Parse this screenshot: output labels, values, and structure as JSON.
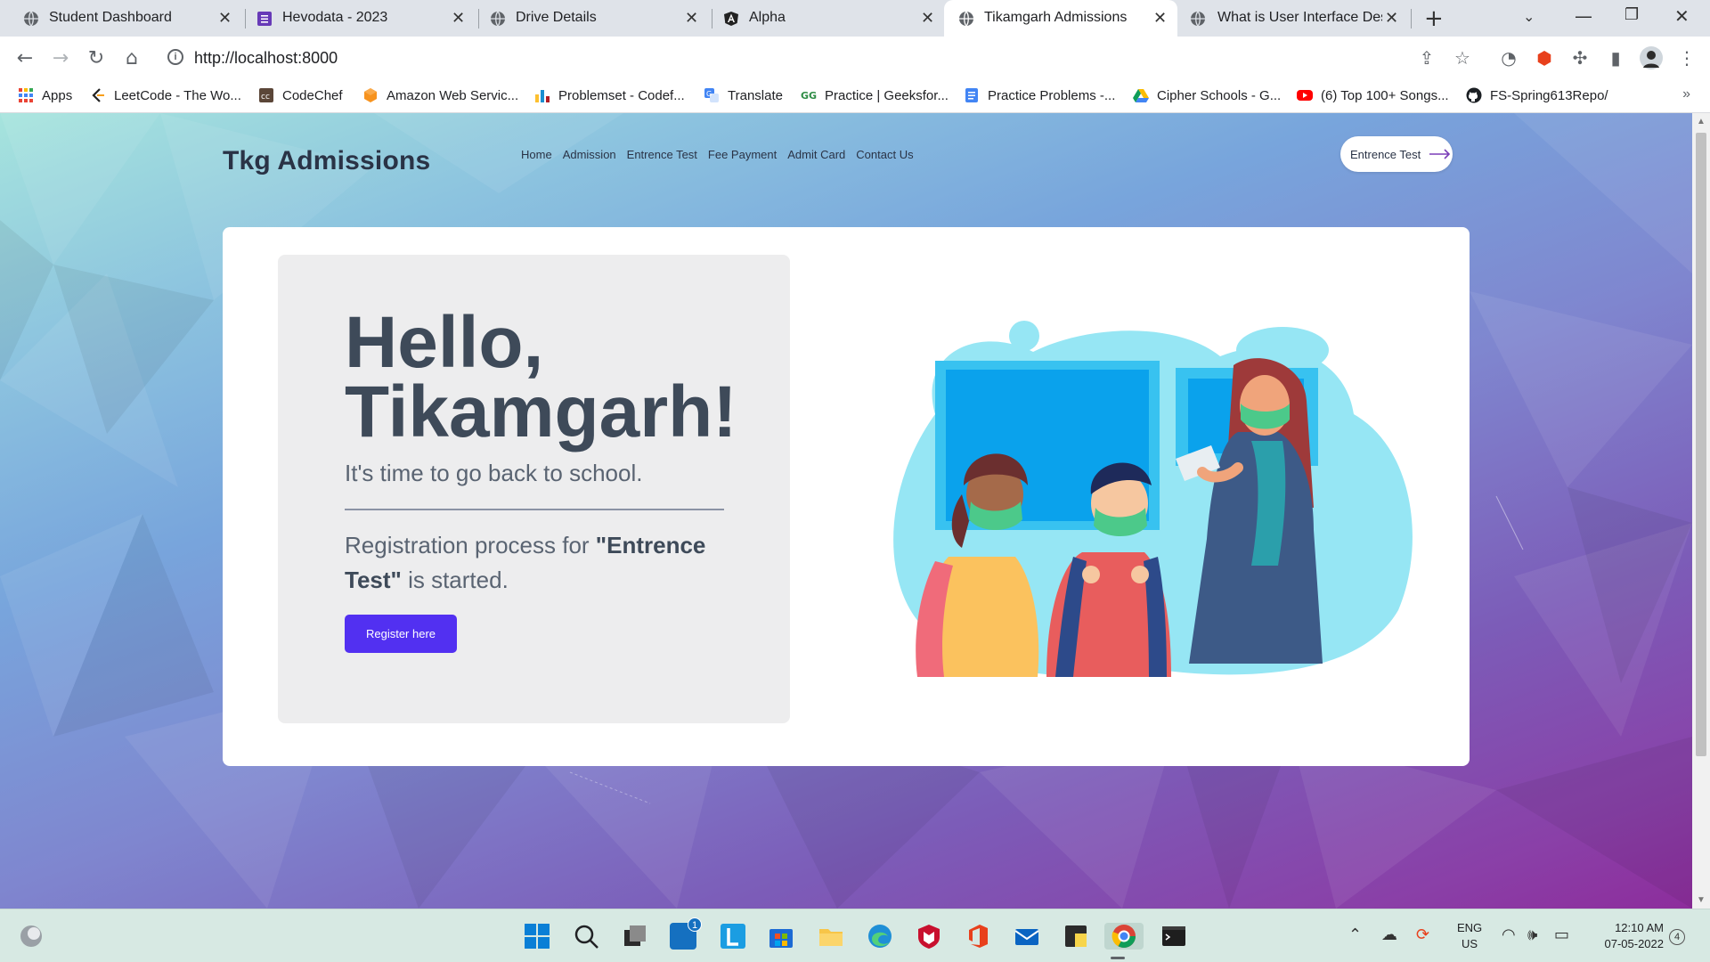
{
  "browser": {
    "tabs": [
      {
        "label": "Student Dashboard",
        "icon": "globe-icon"
      },
      {
        "label": "Hevodata - 2023",
        "icon": "forms-icon"
      },
      {
        "label": "Drive Details",
        "icon": "globe-icon"
      },
      {
        "label": "Alpha",
        "icon": "angular-icon"
      },
      {
        "label": "Tikamgarh Admissions",
        "icon": "globe-icon",
        "active": true
      },
      {
        "label": "What is User Interface Desi",
        "icon": "globe-icon"
      }
    ],
    "url": "http://localhost:8000",
    "bookmarks": [
      {
        "label": "Apps",
        "icon": "apps-grid-icon"
      },
      {
        "label": "LeetCode - The Wo...",
        "icon": "leetcode-icon"
      },
      {
        "label": "CodeChef",
        "icon": "codechef-icon"
      },
      {
        "label": "Amazon Web Servic...",
        "icon": "aws-icon"
      },
      {
        "label": "Problemset - Codef...",
        "icon": "codeforces-icon"
      },
      {
        "label": "Translate",
        "icon": "translate-icon"
      },
      {
        "label": "Practice | Geeksfor...",
        "icon": "geeksforgeeks-icon"
      },
      {
        "label": "Practice Problems -...",
        "icon": "docs-icon"
      },
      {
        "label": "Cipher Schools - G...",
        "icon": "drive-icon"
      },
      {
        "label": "(6) Top 100+ Songs...",
        "icon": "youtube-icon"
      },
      {
        "label": "FS-Spring613Repo/",
        "icon": "github-icon"
      }
    ],
    "more_bookmarks": "»"
  },
  "site": {
    "title": "Tkg Admissions",
    "nav": [
      "Home",
      "Admission",
      "Entrence Test",
      "Fee Payment",
      "Admit Card",
      "Contact Us"
    ],
    "cta_label": "Entrence Test"
  },
  "hero": {
    "hello_line1": "Hello,",
    "hello_line2": "Tikamgarh!",
    "subtitle": "It's time to go back to school.",
    "reg_prefix": "Registration process for ",
    "reg_bold": "\"Entrence Test\"",
    "reg_suffix": " is started.",
    "button_label": "Register here"
  },
  "taskbar": {
    "language": "ENG",
    "region": "US",
    "time": "12:10 AM",
    "date": "07-05-2022",
    "notification_count": "4",
    "badge_count": "1"
  },
  "colors": {
    "accent": "#5230f1",
    "title": "#2a3346",
    "heading": "#3e4a59"
  }
}
